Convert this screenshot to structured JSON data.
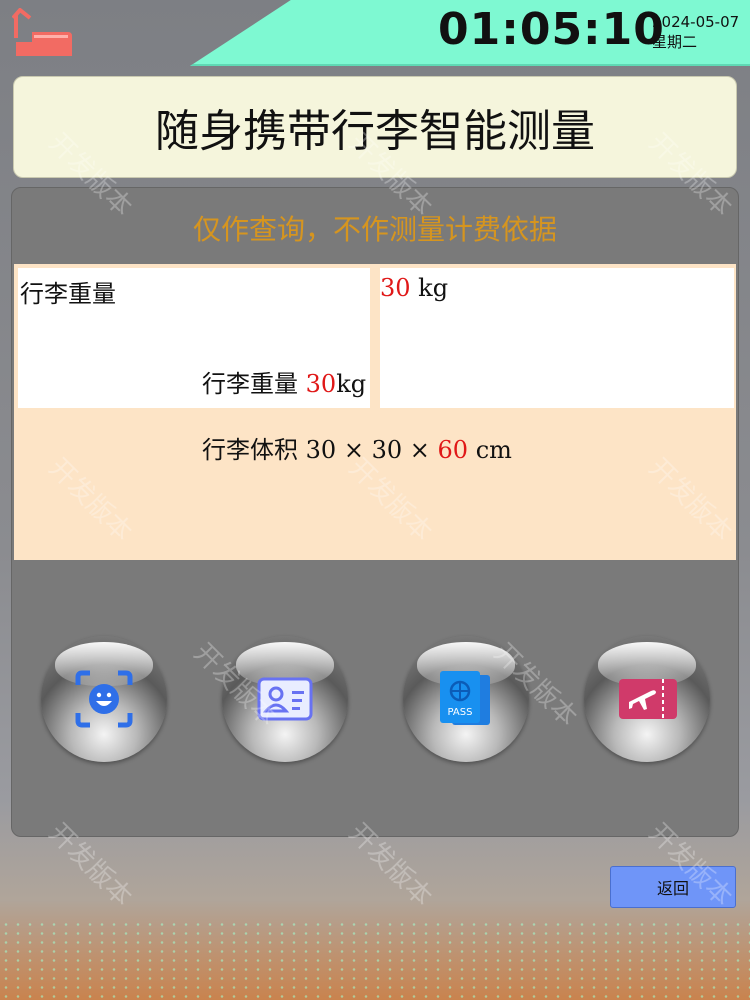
{
  "header": {
    "time": "01:05:10",
    "date": "2024-05-07",
    "weekday": "星期二",
    "home_icon": "home-icon",
    "accent_color": "#7ef9d2"
  },
  "title": "随身携带行李智能测量",
  "notice": "仅作查询，不作测量计费依据",
  "table": {
    "left_label": "行李重量",
    "right_value": "30",
    "right_unit": " kg"
  },
  "weight_row": {
    "label": "行李重量",
    "value": "30",
    "unit": "kg"
  },
  "volume_row": {
    "label": "行李体积",
    "dim1": "30",
    "x1": "×",
    "dim2": "30",
    "x2": "×",
    "dim3": "60",
    "unit": "cm"
  },
  "icons": [
    "face-scan-icon",
    "id-card-icon",
    "passport-icon",
    "boarding-pass-icon"
  ],
  "passport_text": "PASS",
  "back_button": "返回",
  "watermark": "开发版本"
}
